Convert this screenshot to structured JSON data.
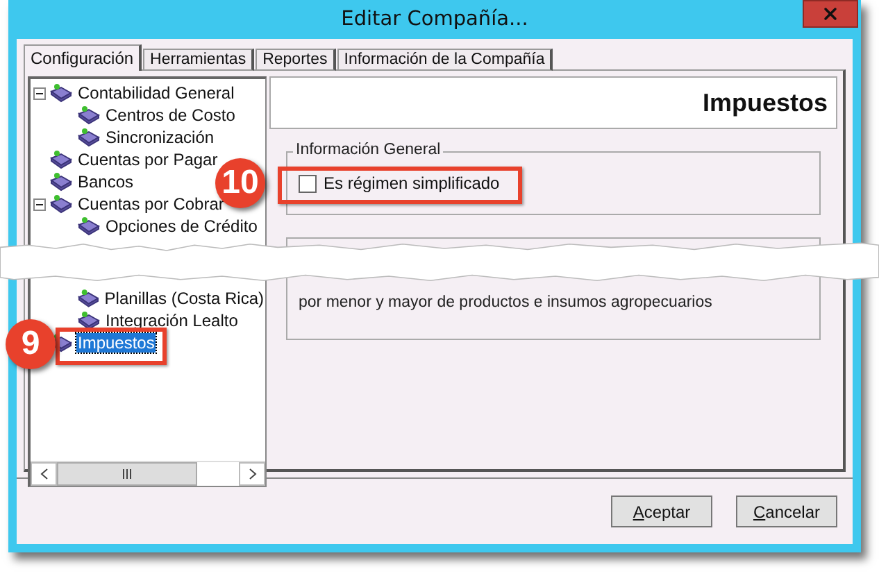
{
  "window": {
    "title": "Editar Compañía..."
  },
  "tabs": [
    {
      "label": "Configuración",
      "selected": true
    },
    {
      "label": "Herramientas",
      "selected": false
    },
    {
      "label": "Reportes",
      "selected": false
    },
    {
      "label": "Información de la Compañía",
      "selected": false
    }
  ],
  "tree": [
    {
      "label": "Contabilidad General",
      "selected": false,
      "expanded": true,
      "children": [
        {
          "label": "Centros de Costo",
          "selected": false
        },
        {
          "label": "Sincronización",
          "selected": false
        }
      ]
    },
    {
      "label": "Cuentas por Pagar",
      "selected": false
    },
    {
      "label": "Bancos",
      "selected": false
    },
    {
      "label": "Cuentas por Cobrar",
      "selected": false,
      "expanded": true,
      "children": [
        {
          "label": "Opciones de Crédito",
          "selected": false
        }
      ]
    }
  ],
  "tree_below_tear": {
    "children": [
      {
        "label": "Planillas (Costa Rica)",
        "selected": false
      },
      {
        "label": "Integración Lealto",
        "selected": false
      }
    ],
    "items": [
      {
        "label": "Impuestos",
        "selected": true
      }
    ]
  },
  "section_title": "Impuestos",
  "general_group": {
    "legend": "Información General",
    "checkbox": {
      "label": "Es régimen simplificado",
      "checked": false
    }
  },
  "exemptions_group": {
    "text_below_tear": "por menor y mayor de productos e insumos agropecuarios"
  },
  "buttons": [
    {
      "label": "Aceptar"
    },
    {
      "label": "Cancelar"
    }
  ],
  "callouts": [
    {
      "number": "10"
    },
    {
      "number": "9"
    }
  ]
}
